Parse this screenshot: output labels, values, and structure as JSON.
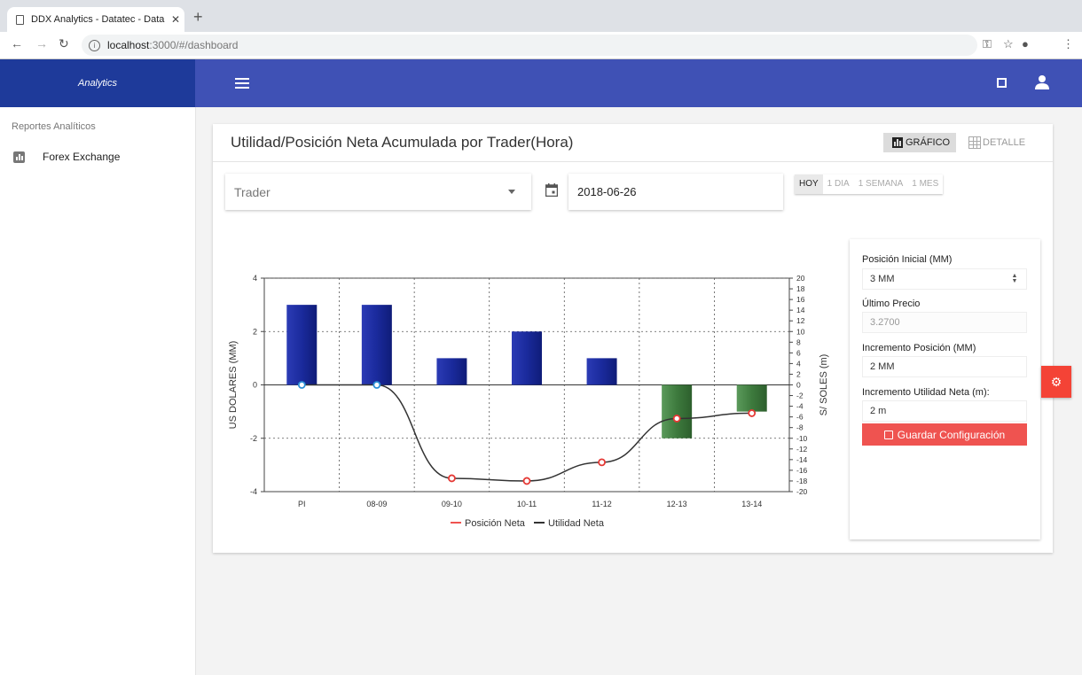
{
  "browser": {
    "tab_title": "DDX Analytics - Datatec - Data",
    "url_host": "localhost",
    "url_path": ":3000/#/dashboard"
  },
  "app": {
    "brand": "Analytics"
  },
  "sidebar": {
    "section_title": "Reportes Analíticos",
    "items": [
      {
        "label": "Forex Exchange",
        "icon": "bar-chart-icon"
      }
    ]
  },
  "card": {
    "title": "Utilidad/Posición Neta Acumulada por Trader(Hora)",
    "view_grafico": "GRÁFICO",
    "view_detalle": "DETALLE"
  },
  "filters": {
    "trader_placeholder": "Trader",
    "date": "2018-06-26",
    "ranges": [
      "HOY",
      "1 DIA",
      "1 SEMANA",
      "1 MES"
    ],
    "active_range": "HOY"
  },
  "config": {
    "posicion_inicial_label": "Posición Inicial (MM)",
    "posicion_inicial_value": "3 MM",
    "ultimo_precio_label": "Último Precio",
    "ultimo_precio_value": "3.2700",
    "incremento_posicion_label": "Incremento Posición (MM)",
    "incremento_posicion_value": "2 MM",
    "incremento_utilidad_label": "Incremento Utilidad Neta (m):",
    "incremento_utilidad_value": "2 m",
    "save_label": "Guardar Configuración"
  },
  "colors": {
    "appbar": "#3f51b5",
    "brand_bg": "#1e3a9a",
    "bar_positive": "#1a2a9c",
    "bar_negative": "#3d7a3d",
    "line": "#333333",
    "marker_positive": "#2b8fd6",
    "marker_negative": "#e53935",
    "accent_red": "#ef5350"
  },
  "chart_data": {
    "type": "bar",
    "categories": [
      "PI",
      "08-09",
      "09-10",
      "10-11",
      "11-12",
      "12-13",
      "13-14"
    ],
    "ylabel": "US DOLARES (MM)",
    "y2label": "S/ SOLES (m)",
    "ylim": [
      -4,
      4
    ],
    "y2lim": [
      -20,
      20
    ],
    "yticks": [
      -4,
      -2,
      0,
      2,
      4
    ],
    "y2ticks": [
      -20,
      -18,
      -16,
      -14,
      -12,
      -10,
      -8,
      -6,
      -4,
      -2,
      0,
      2,
      4,
      6,
      8,
      10,
      12,
      14,
      16,
      18,
      20
    ],
    "grid": true,
    "legend_position": "bottom",
    "series": [
      {
        "name": "Posición Neta",
        "type": "bar",
        "axis": "left",
        "values": [
          3,
          3,
          1,
          2,
          1,
          -2,
          -1
        ]
      },
      {
        "name": "Utilidad Neta",
        "type": "line",
        "axis": "right",
        "values": [
          0,
          0,
          -17.5,
          -18,
          -14.5,
          -6.3,
          -5.3
        ]
      }
    ]
  }
}
